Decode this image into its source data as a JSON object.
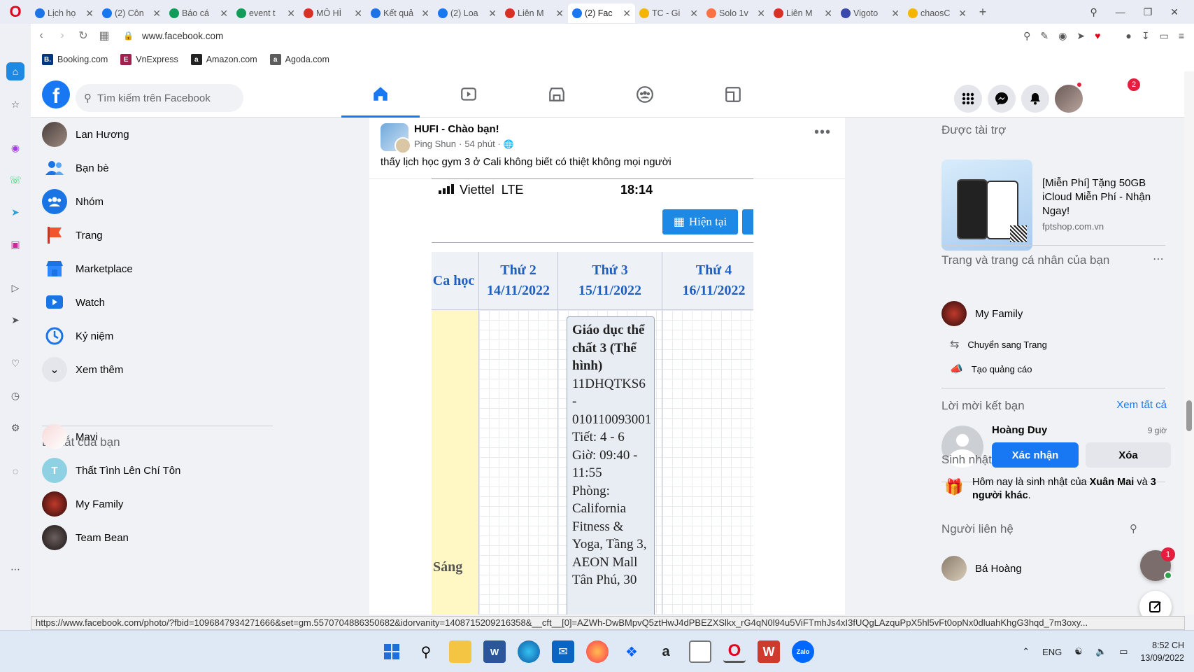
{
  "browser": {
    "tabs": [
      {
        "title": "Lịch họ",
        "color": "#1a73e8",
        "active": false
      },
      {
        "title": "(2) Côn",
        "color": "#1877f2",
        "active": false
      },
      {
        "title": "Báo cá",
        "color": "#0f9d58",
        "active": false
      },
      {
        "title": "event t",
        "color": "#0f9d58",
        "active": false
      },
      {
        "title": "MÔ HÌ",
        "color": "#d93025",
        "active": false
      },
      {
        "title": "Kết quả",
        "color": "#1a73e8",
        "active": false
      },
      {
        "title": "(2) Loa",
        "color": "#1877f2",
        "active": false
      },
      {
        "title": "Liên M",
        "color": "#d93025",
        "active": false
      },
      {
        "title": "(2) Fac",
        "color": "#1877f2",
        "active": true
      },
      {
        "title": "TC - Gi",
        "color": "#f4b400",
        "active": false
      },
      {
        "title": "Solo 1v",
        "color": "#ff7043",
        "active": false
      },
      {
        "title": "Liên M",
        "color": "#d93025",
        "active": false
      },
      {
        "title": "Vigoto",
        "color": "#3949ab",
        "active": false
      },
      {
        "title": "chaosC",
        "color": "#f4b400",
        "active": false
      }
    ],
    "url": "www.facebook.com",
    "bookmarks": [
      {
        "label": "Booking.com",
        "badge": "B.",
        "color": "#003580"
      },
      {
        "label": "VnExpress",
        "badge": "E",
        "color": "#9f224e"
      },
      {
        "label": "Amazon.com",
        "badge": "a",
        "color": "#222222"
      },
      {
        "label": "Agoda.com",
        "badge": "a",
        "color": "#5c5c5c"
      }
    ],
    "status_url": "https://www.facebook.com/photo/?fbid=1096847934271666&set=gm.5570704886350682&idorvanity=1408715209216358&__cft__[0]=AZWh-DwBMpvQ5ztHwJ4dPBEZXSlkx_rG4qN0l94u5ViFTmhJs4xI3fUQgLAzquPpX5hl5vFt0opNx0dluahKhgG3hqd_7m3oxy..."
  },
  "facebook": {
    "search_placeholder": "Tìm kiếm trên Facebook",
    "notification_count": "2",
    "left_nav": [
      {
        "label": "Lan Hương",
        "icon": "profile-avatar"
      },
      {
        "label": "Bạn bè",
        "icon": "friends-icon"
      },
      {
        "label": "Nhóm",
        "icon": "groups-icon"
      },
      {
        "label": "Trang",
        "icon": "pages-flag-icon"
      },
      {
        "label": "Marketplace",
        "icon": "marketplace-icon"
      },
      {
        "label": "Watch",
        "icon": "watch-icon"
      },
      {
        "label": "Kỷ niệm",
        "icon": "memories-icon"
      },
      {
        "label": "Xem thêm",
        "icon": "chevron-down-icon"
      }
    ],
    "shortcuts_title": "Lối tắt của bạn",
    "shortcuts": [
      {
        "label": "Mavi",
        "avatar_letter": ""
      },
      {
        "label": "Thất Tình Lên Chí Tôn",
        "avatar_letter": "T"
      },
      {
        "label": "My Family",
        "avatar_letter": ""
      },
      {
        "label": "Team Bean",
        "avatar_letter": ""
      }
    ],
    "post": {
      "group": "HUFI - Chào bạn!",
      "author": "Ping Shun",
      "time": "54 phút ·",
      "text": "thấy lịch học gym 3 ở Cali không biết có thiệt không mọi người",
      "photo": {
        "carrier": "Viettel",
        "network": "LTE",
        "clock": "18:14",
        "button": "Hiện tại",
        "col0": "Ca học",
        "days": [
          {
            "day": "Thứ 2",
            "date": "14/11/2022"
          },
          {
            "day": "Thứ 3",
            "date": "15/11/2022"
          },
          {
            "day": "Thứ 4",
            "date": "16/11/2022"
          }
        ],
        "session": "Sáng",
        "class_title": "Giáo dục thể chất 3 (Thể hình)",
        "class_lines": [
          "11DHQTKS6",
          "-",
          "010110093001",
          "Tiết: 4 - 6",
          "Giờ: 09:40 -",
          "11:55",
          "Phòng:",
          "California",
          "Fitness &",
          "Yoga, Tầng 3,",
          "AEON Mall",
          "Tân Phú, 30"
        ]
      }
    },
    "right": {
      "sponsored_title": "Được tài trợ",
      "ad_title": "[Miễn Phí] Tặng 50GB iCloud Miễn Phí - Nhận Ngay!",
      "ad_site": "fptshop.com.vn",
      "pages_title": "Trang và trang cá nhân của bạn",
      "page_name": "My Family",
      "switch_label": "Chuyển sang Trang",
      "ad_create_label": "Tạo quảng cáo",
      "friend_requests_title": "Lời mời kết bạn",
      "see_all": "Xem tất cả",
      "request_name": "Hoàng Duy",
      "request_time": "9 giờ",
      "confirm": "Xác nhận",
      "delete": "Xóa",
      "birthday_title": "Sinh nhật",
      "birthday_prefix": "Hôm nay là sinh nhật của ",
      "birthday_name": "Xuân Mai",
      "birthday_mid": " và ",
      "birthday_others": "3 người khác",
      "birthday_suffix": ".",
      "contacts_title": "Người liên hệ",
      "contact_name": "Bá Hoàng",
      "chat_badge": "1"
    }
  },
  "taskbar": {
    "lang": "ENG",
    "time": "8:52 CH",
    "date": "13/09/2022"
  }
}
